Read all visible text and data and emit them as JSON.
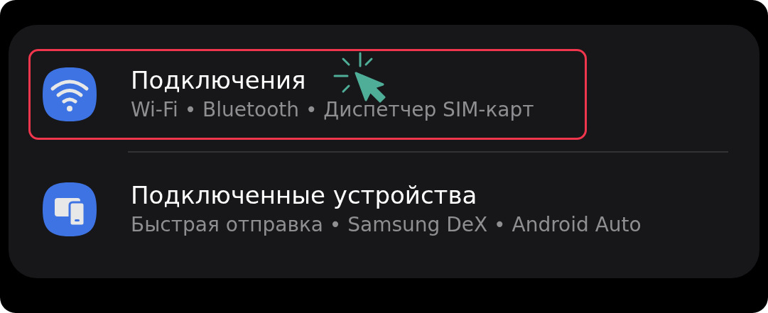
{
  "items": [
    {
      "kind": "wifi",
      "title": "Подключения",
      "subtitle": "Wi-Fi • Bluetooth • Диспетчер SIM-карт",
      "highlighted": true,
      "pointer": true
    },
    {
      "kind": "devices",
      "title": "Подключенные устройства",
      "subtitle": "Быстрая отправка • Samsung DeX • Android Auto",
      "highlighted": false,
      "pointer": false
    }
  ]
}
